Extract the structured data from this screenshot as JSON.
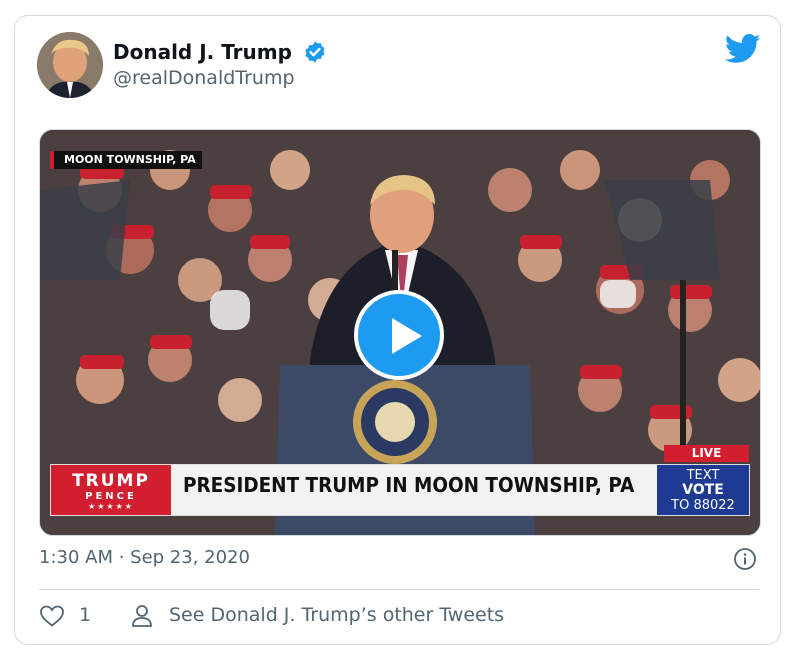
{
  "author": {
    "name": "Donald J. Trump",
    "handle": "@realDonaldTrump"
  },
  "video": {
    "location_tag": "MOON TOWNSHIP, PA",
    "live_label": "LIVE",
    "logo": {
      "line1": "TRUMP",
      "line2": "PENCE",
      "stars": "★★★★★"
    },
    "headline": "PRESIDENT TRUMP IN MOON TOWNSHIP, PA",
    "cta": {
      "line1": "TEXT",
      "line2": "VOTE",
      "line3": "TO 88022"
    }
  },
  "timestamp": "1:30 AM · Sep 23, 2020",
  "actions": {
    "like_count": "1",
    "see_more": "See Donald J. Trump’s other Tweets"
  },
  "icons": {
    "verified": "verified-badge-icon",
    "brand": "twitter-bird-icon",
    "play": "play-icon",
    "info": "info-icon",
    "like": "heart-icon",
    "person": "person-icon"
  },
  "colors": {
    "accent": "#1d9bf0",
    "red": "#d21f2f",
    "navy": "#1f3a93",
    "muted": "#536471"
  }
}
